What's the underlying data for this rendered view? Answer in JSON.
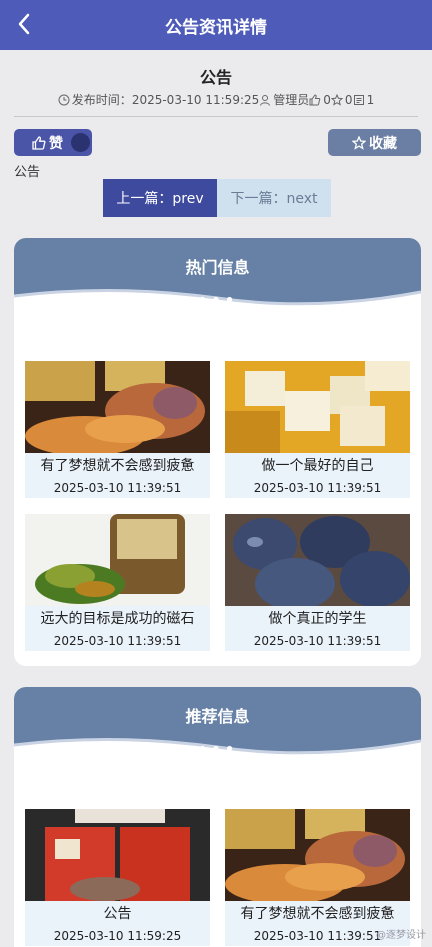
{
  "header": {
    "title": "公告资讯详情",
    "back_icon": "back-arrow-icon"
  },
  "article": {
    "title": "公告",
    "publish_label": "发布时间：",
    "publish_time": "2025-03-10 11:59:25",
    "author": "管理员",
    "likes": "0",
    "favorites": "0",
    "views": "1",
    "content": "公告"
  },
  "actions": {
    "like_label": "赞",
    "favorite_label": "收藏"
  },
  "pager": {
    "prev_label": "上一篇：prev",
    "next_label": "下一篇：next"
  },
  "hot": {
    "title": "热门信息",
    "dots": "•••",
    "items": [
      {
        "title": "有了梦想就不会感到疲惫",
        "date": "2025-03-10 11:39:51"
      },
      {
        "title": "做一个最好的自己",
        "date": "2025-03-10 11:39:51"
      },
      {
        "title": "远大的目标是成功的磁石",
        "date": "2025-03-10 11:39:51"
      },
      {
        "title": "做个真正的学生",
        "date": "2025-03-10 11:39:51"
      }
    ]
  },
  "recommend": {
    "title": "推荐信息",
    "dots": "•••",
    "items": [
      {
        "title": "公告",
        "date": "2025-03-10 11:59:25"
      },
      {
        "title": "有了梦想就不会感到疲惫",
        "date": "2025-03-10 11:39:51"
      }
    ]
  },
  "watermark": "@逐梦设计",
  "colors": {
    "header": "#4f5bb8",
    "panel_head": "#6681a5",
    "card_bg": "#eaf2fa"
  }
}
